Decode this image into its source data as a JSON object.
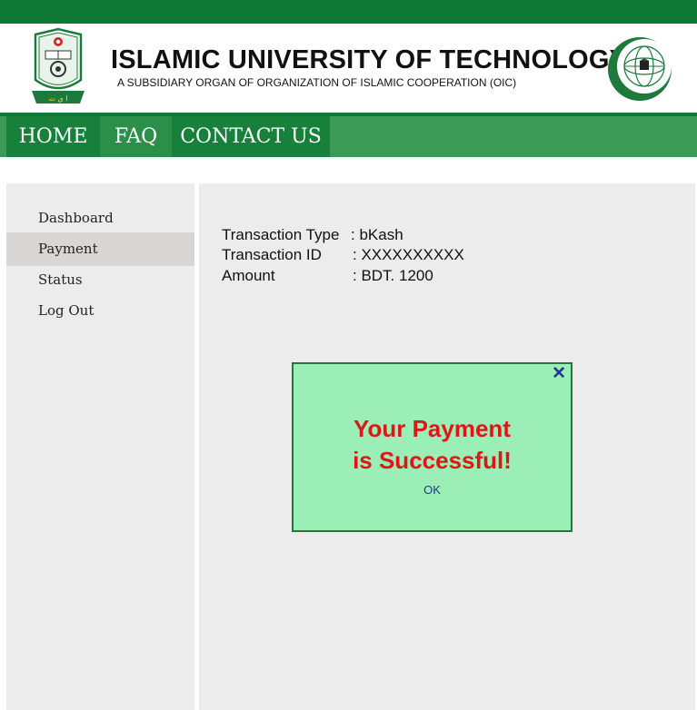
{
  "header": {
    "title": "ISLAMIC UNIVERSITY OF TECHNOLOGY",
    "subtitle": "A SUBSIDIARY ORGAN OF ORGANIZATION OF ISLAMIC COOPERATION (OIC)",
    "brand_color": "#0e7a35",
    "left_logo": "iut-crest-logo",
    "right_logo": "oic-globe-logo"
  },
  "nav": {
    "items": [
      {
        "label": "HOME"
      },
      {
        "label": "FAQ"
      },
      {
        "label": "CONTACT US"
      }
    ]
  },
  "sidebar": {
    "items": [
      {
        "label": "Dashboard"
      },
      {
        "label": "Payment",
        "active": true
      },
      {
        "label": "Status"
      },
      {
        "label": "Log Out"
      }
    ]
  },
  "transaction": {
    "type_label": "Transaction Type",
    "type_value": ": bKash",
    "id_label": "Transaction ID",
    "id_value": ": XXXXXXXXXX",
    "amount_label": "Amount",
    "amount_value": ": BDT. 1200"
  },
  "modal": {
    "close_icon": "close-icon",
    "message_line1": "Your Payment",
    "message_line2": "is Successful!",
    "ok_label": "OK",
    "message_color": "#e01616",
    "background_color": "#9aeeb6"
  }
}
